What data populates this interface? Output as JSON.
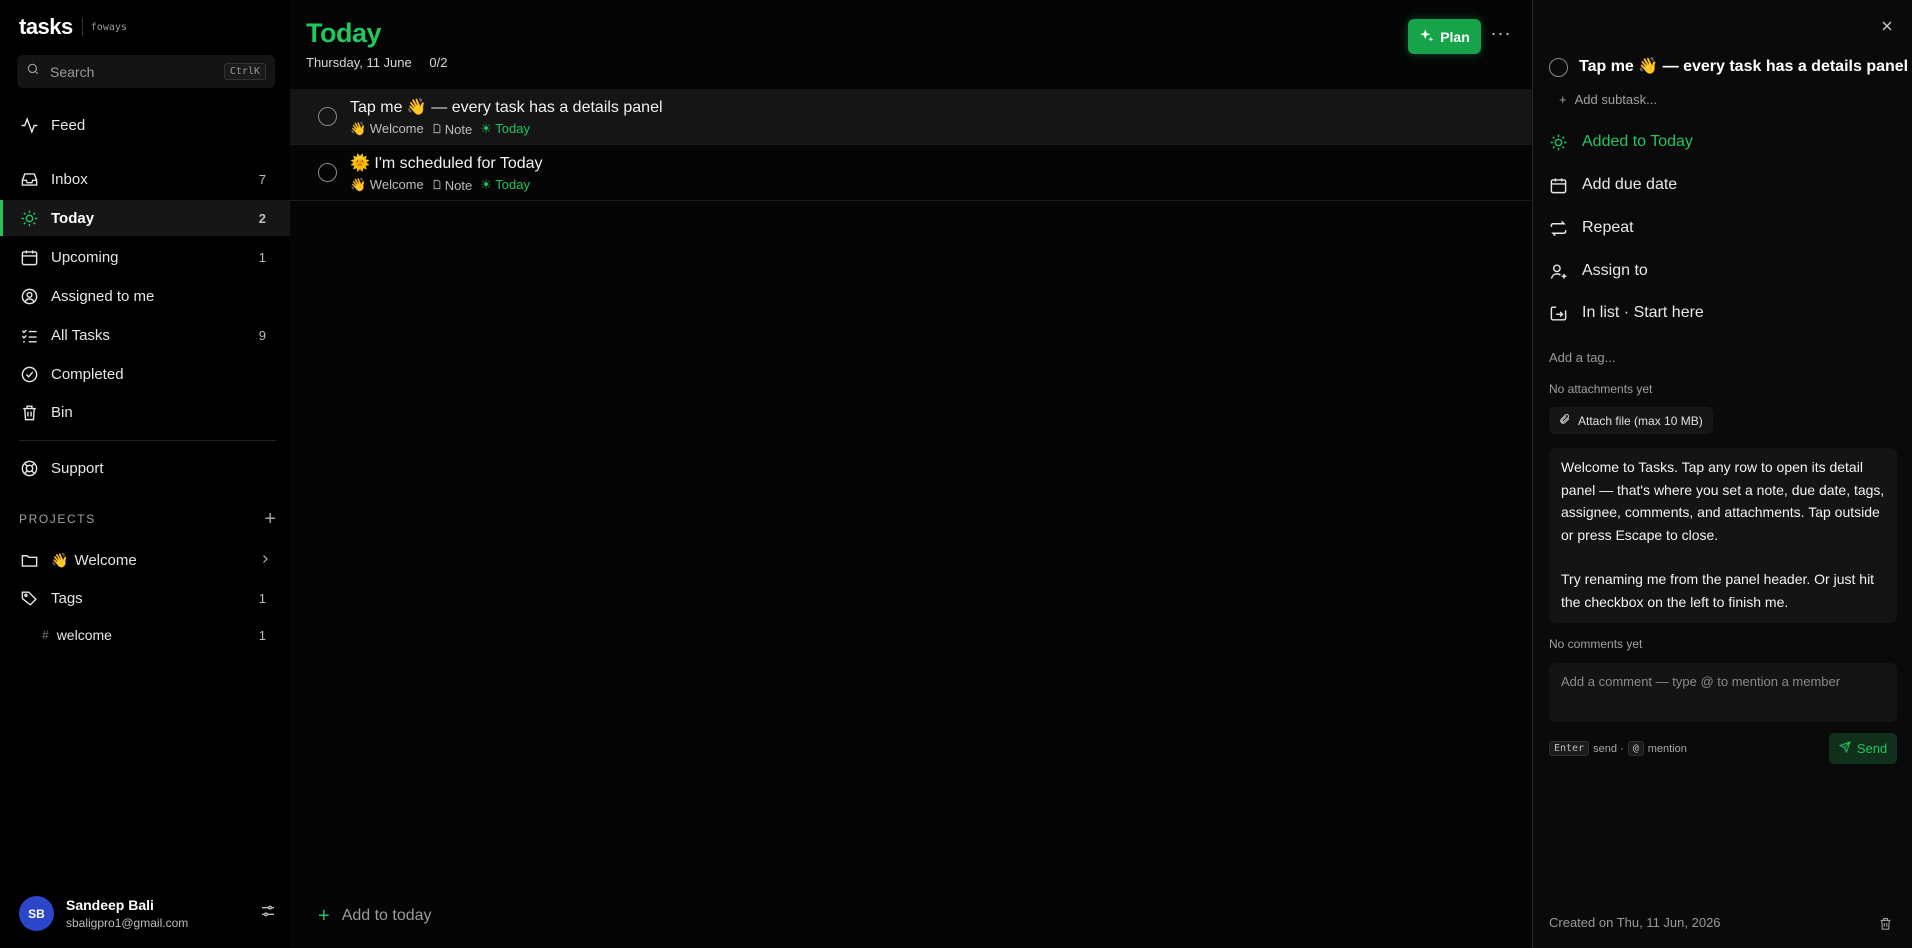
{
  "brand": {
    "name": "tasks",
    "workspace": "foways"
  },
  "search": {
    "placeholder": "Search",
    "shortcut": "CtrlK"
  },
  "nav": [
    {
      "label": "Feed",
      "icon": "activity-icon",
      "count": ""
    },
    {
      "label": "Inbox",
      "icon": "inbox-icon",
      "count": "7"
    },
    {
      "label": "Today",
      "icon": "sun-icon",
      "count": "2",
      "active": true
    },
    {
      "label": "Upcoming",
      "icon": "calendar-icon",
      "count": "1"
    },
    {
      "label": "Assigned to me",
      "icon": "user-circle-icon",
      "count": ""
    },
    {
      "label": "All Tasks",
      "icon": "list-checks-icon",
      "count": "9"
    },
    {
      "label": "Completed",
      "icon": "check-circle-icon",
      "count": ""
    },
    {
      "label": "Bin",
      "icon": "trash-icon",
      "count": ""
    }
  ],
  "support": {
    "label": "Support",
    "icon": "lifebuoy-icon"
  },
  "projects": {
    "header": "PROJECTS",
    "items": [
      {
        "emoji": "👋",
        "label": "Welcome",
        "icon": "folder-icon"
      }
    ]
  },
  "tags": {
    "label": "Tags",
    "count": "1",
    "items": [
      {
        "label": "welcome",
        "count": "1"
      }
    ]
  },
  "user": {
    "initials": "SB",
    "name": "Sandeep Bali",
    "email": "sbaligpro1@gmail.com"
  },
  "main": {
    "title": "Today",
    "date": "Thursday, 11 June",
    "progress": "0/2",
    "plan_label": "Plan",
    "more_label": "···",
    "add_label": "Add to today"
  },
  "tasks": [
    {
      "title": "Tap me  👋 — every task has a details panel",
      "project": "👋 Welcome",
      "note": "Note",
      "when": "Today"
    },
    {
      "title": "🌞 I'm scheduled for Today",
      "project": "👋 Welcome",
      "note": "Note",
      "when": "Today"
    }
  ],
  "panel": {
    "title": "Tap me  👋 — every task has a details panel",
    "add_subtask": "Add subtask...",
    "added_today": "Added to Today",
    "due_date": "Add due date",
    "repeat": "Repeat",
    "assign": "Assign to",
    "in_list": "In list · Start here",
    "add_tag": "Add a tag...",
    "no_attachments": "No attachments yet",
    "attach": "Attach file (max 10 MB)",
    "note_p1": "Welcome to Tasks. Tap any row to open its detail panel — that's where you set a note, due date, tags, assignee, comments, and attachments. Tap outside or press Escape to close.",
    "note_p2": "Try renaming me from the panel header. Or just hit the checkbox on the left to finish me.",
    "no_comments": "No comments yet",
    "comment_placeholder": "Add a comment — type @ to mention a member",
    "hint_enter": "Enter",
    "hint_send": "send ·",
    "hint_at": "@",
    "hint_mention": "mention",
    "send": "Send",
    "created": "Created on Thu, 11 Jun, 2026"
  },
  "colors": {
    "accent": "#22c55e",
    "plan_bg": "#16a34a",
    "avatar": "#2b46c8",
    "background": "#000000"
  }
}
